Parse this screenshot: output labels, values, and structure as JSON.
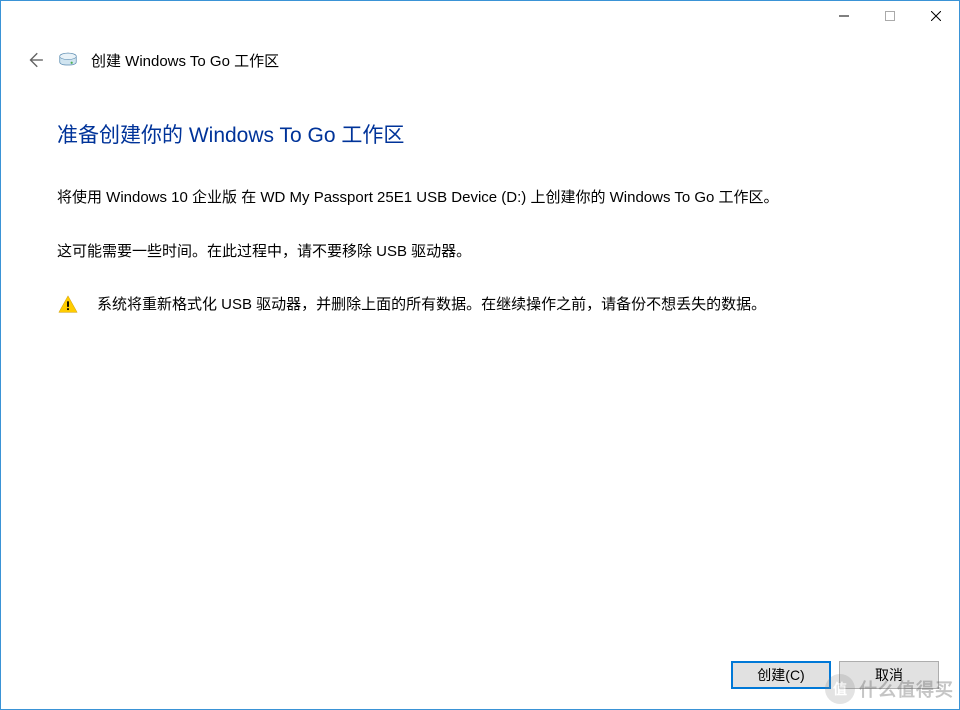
{
  "titlebar": {
    "minimize": "minimize",
    "maximize": "maximize",
    "close": "close"
  },
  "header": {
    "title": "创建 Windows To Go 工作区"
  },
  "content": {
    "heading": "准备创建你的 Windows To Go 工作区",
    "paragraph1": "将使用 Windows 10 企业版 在 WD My Passport 25E1 USB Device (D:) 上创建你的 Windows To Go 工作区。",
    "paragraph2": "这可能需要一些时间。在此过程中，请不要移除 USB 驱动器。",
    "warning": "系统将重新格式化 USB 驱动器，并删除上面的所有数据。在继续操作之前，请备份不想丢失的数据。"
  },
  "footer": {
    "create_label": "创建(C)",
    "cancel_label": "取消"
  },
  "watermark": {
    "badge": "值",
    "text": "什么值得买"
  }
}
